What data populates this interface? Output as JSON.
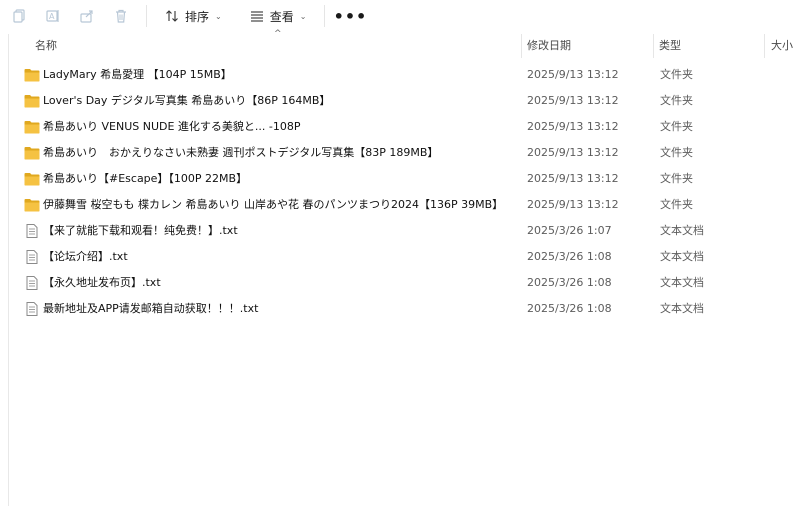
{
  "toolbar": {
    "icons": [
      "copy-icon",
      "rename-icon",
      "share-icon",
      "delete-icon"
    ],
    "sort_label": "排序",
    "view_label": "查看",
    "more_label": "•••"
  },
  "columns": {
    "name": "名称",
    "date": "修改日期",
    "type": "类型",
    "size": "大小"
  },
  "files": [
    {
      "name": "LadyMary 希島愛理 【104P 15MB】",
      "date": "2025/9/13 13:12",
      "type": "文件夹",
      "kind": "folder"
    },
    {
      "name": "Lover's Day デジタル写真集 希島あいり【86P 164MB】",
      "date": "2025/9/13 13:12",
      "type": "文件夹",
      "kind": "folder"
    },
    {
      "name": "希島あいり VENUS NUDE 進化する美貌と... -108P",
      "date": "2025/9/13 13:12",
      "type": "文件夹",
      "kind": "folder"
    },
    {
      "name": "希島あいり　おかえりなさい未熟妻 週刊ポストデジタル写真集【83P 189MB】",
      "date": "2025/9/13 13:12",
      "type": "文件夹",
      "kind": "folder"
    },
    {
      "name": "希島あいり【#Escape】【100P 22MB】",
      "date": "2025/9/13 13:12",
      "type": "文件夹",
      "kind": "folder"
    },
    {
      "name": "伊藤舞雪 桜空もも 楪カレン 希島あいり 山岸あや花  春のパンツまつり2024【136P 39MB】",
      "date": "2025/9/13 13:12",
      "type": "文件夹",
      "kind": "folder"
    },
    {
      "name": "【来了就能下载和观看！纯免费！】.txt",
      "date": "2025/3/26 1:07",
      "type": "文本文档",
      "kind": "text"
    },
    {
      "name": "【论坛介绍】.txt",
      "date": "2025/3/26 1:08",
      "type": "文本文档",
      "kind": "text"
    },
    {
      "name": "【永久地址发布页】.txt",
      "date": "2025/3/26 1:08",
      "type": "文本文档",
      "kind": "text"
    },
    {
      "name": "最新地址及APP请发邮箱自动获取！！！.txt",
      "date": "2025/3/26 1:08",
      "type": "文本文档",
      "kind": "text"
    }
  ],
  "colors": {
    "folder": "#f5c242",
    "folder_dark": "#e0a81f",
    "text_icon": "#8a8a8a"
  }
}
